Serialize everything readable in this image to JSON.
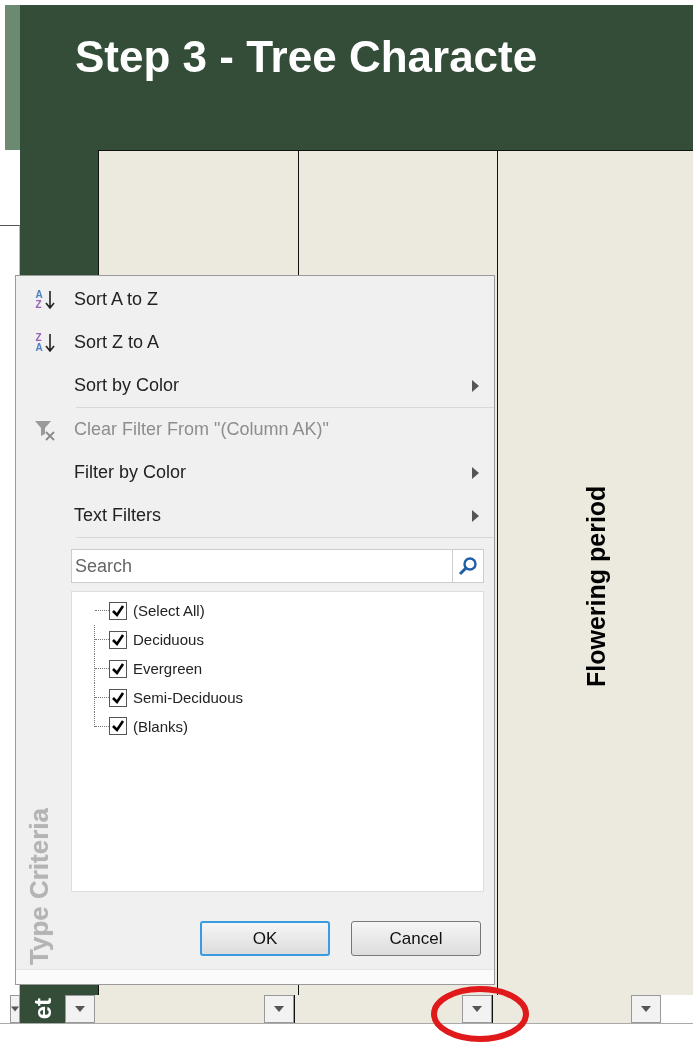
{
  "sheet": {
    "title": "Step 3 - Tree Characte",
    "tab_label": "et",
    "column_header": "Flowering period",
    "background_label": "Type Criteria"
  },
  "filter_menu": {
    "sections": [
      [
        {
          "label": "Sort A to Z",
          "kind": "sort-asc",
          "icon_letters": [
            "A",
            "Z"
          ],
          "submenu": false,
          "disabled": false
        },
        {
          "label": "Sort Z to A",
          "kind": "sort-desc",
          "icon_letters": [
            "Z",
            "A"
          ],
          "submenu": false,
          "disabled": false
        },
        {
          "label": "Sort by Color",
          "kind": "plain",
          "submenu": true,
          "disabled": false
        }
      ],
      [
        {
          "label": "Clear Filter From \"(Column AK)\"",
          "kind": "clear-filter",
          "submenu": false,
          "disabled": true
        },
        {
          "label": "Filter by Color",
          "kind": "plain",
          "submenu": true,
          "disabled": false
        },
        {
          "label": "Text Filters",
          "kind": "plain",
          "submenu": true,
          "disabled": false
        }
      ]
    ],
    "search": {
      "placeholder": "Search"
    },
    "values": [
      {
        "label": "(Select All)",
        "checked": true
      },
      {
        "label": "Deciduous",
        "checked": true
      },
      {
        "label": "Evergreen",
        "checked": true
      },
      {
        "label": "Semi-Deciduous",
        "checked": true
      },
      {
        "label": "(Blanks)",
        "checked": true
      }
    ],
    "buttons": [
      {
        "label": "OK",
        "default": true
      },
      {
        "label": "Cancel",
        "default": false
      }
    ]
  }
}
